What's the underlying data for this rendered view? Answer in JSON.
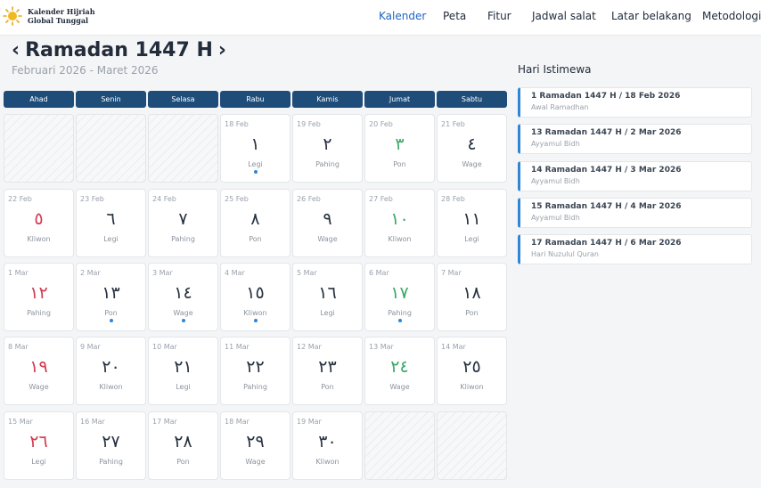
{
  "header": {
    "brand_line1": "Kalender Hijriah",
    "brand_line2": "Global Tunggal",
    "nav": [
      "Kalender",
      "Peta",
      "Fitur",
      "Jadwal salat",
      "Latar belakang",
      "Metodologi"
    ],
    "active_nav": "Kalender"
  },
  "month": {
    "prev_label": "‹",
    "title": "Ramadan 1447 H",
    "next_label": "›",
    "subtitle": "Februari 2026 - Maret 2026"
  },
  "weekdays": [
    "Ahad",
    "Senin",
    "Selasa",
    "Rabu",
    "Kamis",
    "Jumat",
    "Sabtu"
  ],
  "calendar": [
    {
      "empty": true
    },
    {
      "empty": true
    },
    {
      "empty": true
    },
    {
      "g": "18 Feb",
      "h": "١",
      "p": "Legi",
      "dot": true
    },
    {
      "g": "19 Feb",
      "h": "٢",
      "p": "Pahing"
    },
    {
      "g": "20 Feb",
      "h": "٣",
      "p": "Pon"
    },
    {
      "g": "21 Feb",
      "h": "٤",
      "p": "Wage"
    },
    {
      "g": "22 Feb",
      "h": "٥",
      "p": "Kliwon"
    },
    {
      "g": "23 Feb",
      "h": "٦",
      "p": "Legi"
    },
    {
      "g": "24 Feb",
      "h": "٧",
      "p": "Pahing"
    },
    {
      "g": "25 Feb",
      "h": "٨",
      "p": "Pon"
    },
    {
      "g": "26 Feb",
      "h": "٩",
      "p": "Wage"
    },
    {
      "g": "27 Feb",
      "h": "١٠",
      "p": "Kliwon"
    },
    {
      "g": "28 Feb",
      "h": "١١",
      "p": "Legi"
    },
    {
      "g": "1 Mar",
      "h": "١٢",
      "p": "Pahing"
    },
    {
      "g": "2 Mar",
      "h": "١٣",
      "p": "Pon",
      "dot": true
    },
    {
      "g": "3 Mar",
      "h": "١٤",
      "p": "Wage",
      "dot": true
    },
    {
      "g": "4 Mar",
      "h": "١٥",
      "p": "Kliwon",
      "dot": true
    },
    {
      "g": "5 Mar",
      "h": "١٦",
      "p": "Legi"
    },
    {
      "g": "6 Mar",
      "h": "١٧",
      "p": "Pahing",
      "dot": true
    },
    {
      "g": "7 Mar",
      "h": "١٨",
      "p": "Pon"
    },
    {
      "g": "8 Mar",
      "h": "١٩",
      "p": "Wage"
    },
    {
      "g": "9 Mar",
      "h": "٢٠",
      "p": "Kliwon"
    },
    {
      "g": "10 Mar",
      "h": "٢١",
      "p": "Legi"
    },
    {
      "g": "11 Mar",
      "h": "٢٢",
      "p": "Pahing"
    },
    {
      "g": "12 Mar",
      "h": "٢٣",
      "p": "Pon"
    },
    {
      "g": "13 Mar",
      "h": "٢٤",
      "p": "Wage"
    },
    {
      "g": "14 Mar",
      "h": "٢٥",
      "p": "Kliwon"
    },
    {
      "g": "15 Mar",
      "h": "٢٦",
      "p": "Legi"
    },
    {
      "g": "16 Mar",
      "h": "٢٧",
      "p": "Pahing"
    },
    {
      "g": "17 Mar",
      "h": "٢٨",
      "p": "Pon"
    },
    {
      "g": "18 Mar",
      "h": "٢٩",
      "p": "Wage"
    },
    {
      "g": "19 Mar",
      "h": "٣٠",
      "p": "Kliwon"
    },
    {
      "empty": true
    },
    {
      "empty": true
    }
  ],
  "sidebar": {
    "title": "Hari Istimewa",
    "events": [
      {
        "title": "1 Ramadan 1447 H / 18 Feb 2026",
        "subtitle": "Awal Ramadhan"
      },
      {
        "title": "13 Ramadan 1447 H / 2 Mar 2026",
        "subtitle": "Ayyamul Bidh"
      },
      {
        "title": "14 Ramadan 1447 H / 3 Mar 2026",
        "subtitle": "Ayyamul Bidh"
      },
      {
        "title": "15 Ramadan 1447 H / 4 Mar 2026",
        "subtitle": "Ayyamul Bidh"
      },
      {
        "title": "17 Ramadan 1447 H / 6 Mar 2026",
        "subtitle": "Hari Nuzulul Quran"
      }
    ]
  },
  "colors": {
    "accent": "#1e64c8",
    "weekday_header": "#1f4d7a",
    "friday": "#3aa867",
    "sunday": "#d23a4e",
    "event_marker": "#2f86d4"
  },
  "icons": {
    "logo": "sun-logo-icon",
    "event_dot": "event-dot-icon"
  }
}
